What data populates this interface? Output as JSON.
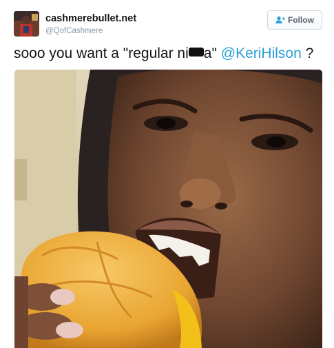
{
  "author": {
    "display_name": "cashmerebullet.net",
    "handle": "@QofCashmere",
    "avatar_icon": "user-avatar-photo"
  },
  "follow_button": {
    "label": "Follow",
    "icon": "add-user-icon",
    "color": "#2b9fd9"
  },
  "tweet": {
    "text_before": "sooo you want a \"regular ni",
    "text_after": "a\" ",
    "mention": "@KeriHilson",
    "text_end": " ?",
    "mention_color": "#2b9fd9"
  },
  "media": {
    "type": "photo",
    "icon": "photo-person-eating-burger"
  }
}
